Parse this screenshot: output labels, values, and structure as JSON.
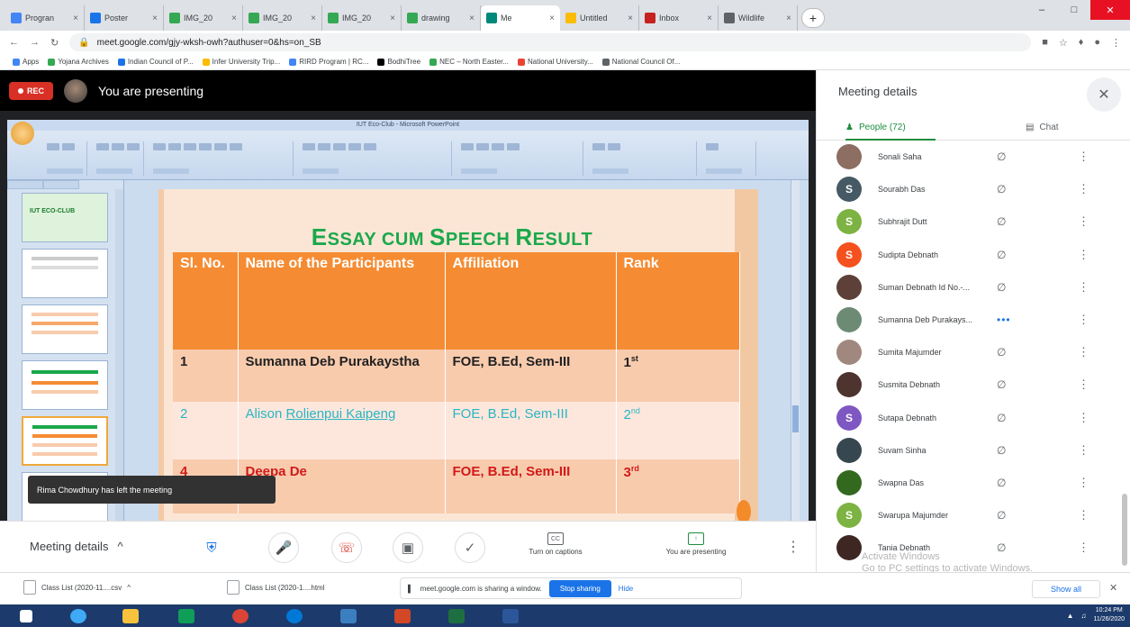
{
  "browser": {
    "tabs": [
      {
        "label": "Progran",
        "color": "#4285f4"
      },
      {
        "label": "Poster",
        "color": "#1a73e8"
      },
      {
        "label": "IMG_20",
        "color": "#34a853"
      },
      {
        "label": "IMG_20",
        "color": "#34a853"
      },
      {
        "label": "IMG_20",
        "color": "#34a853"
      },
      {
        "label": "drawing",
        "color": "#34a853"
      },
      {
        "label": "Me",
        "color": "#00897b"
      },
      {
        "label": "Untitled",
        "color": "#fbbc04"
      },
      {
        "label": "Inbox",
        "color": "#c5221f"
      },
      {
        "label": "Wildlife",
        "color": "#5f6368"
      }
    ],
    "url": "meet.google.com/gjy-wksh-owh?authuser=0&hs=on_SB",
    "bookmarks": [
      "Apps",
      "Yojana Archives",
      "Indian Council of P...",
      "Infer University Trip...",
      "RIRD Program | RC...",
      "BodhiTree",
      "NEC – North Easter...",
      "National University...",
      "National Council Of..."
    ]
  },
  "meet": {
    "rec_label": "REC",
    "presenting_text": "You are presenting",
    "toast": "Rima Chowdhury has left the meeting",
    "controls": {
      "meeting_details": "Meeting details",
      "captions": "Turn on captions",
      "presenting": "You are presenting"
    }
  },
  "ppt": {
    "title": "IUT Eco-Club - Microsoft PowerPoint",
    "thumb_label": "IUT ECO-CLUB"
  },
  "slide": {
    "title_e": "E",
    "title_ssay": "SSAY CUM ",
    "title_s": "S",
    "title_peech": "PEECH ",
    "title_r": "R",
    "title_esult": "ESULT",
    "headers": {
      "slno": "Sl. No.",
      "name": "Name of the Participants",
      "affiliation": "Affiliation",
      "rank": "Rank"
    },
    "rows": [
      {
        "no": "1",
        "name": "Sumanna Deb Purakaystha",
        "affiliation": "FOE, B.Ed, Sem-III",
        "rank": "1",
        "rank_sup": "st"
      },
      {
        "no": "2",
        "name_first": "Alison ",
        "name_rest": "Rolienpui Kaipeng",
        "affiliation": "FOE, B.Ed, Sem-III",
        "rank": "2",
        "rank_sup": "nd"
      },
      {
        "no": "4",
        "name": "Deepa De",
        "affiliation": "FOE, B.Ed, Sem-III",
        "rank": "3",
        "rank_sup": "rd"
      }
    ]
  },
  "panel": {
    "title": "Meeting details",
    "people_tab": "People (72)",
    "chat_tab": "Chat",
    "participants": [
      {
        "name": "Sonali Saha",
        "initial": "",
        "color": "#8d6e63"
      },
      {
        "name": "Sourabh Das",
        "initial": "S",
        "color": "#455a64"
      },
      {
        "name": "Subhrajit Dutt",
        "initial": "S",
        "color": "#7cb342"
      },
      {
        "name": "Sudipta Debnath",
        "initial": "S",
        "color": "#f4511e"
      },
      {
        "name": "Suman Debnath Id No.-...",
        "initial": "",
        "color": "#5d4037"
      },
      {
        "name": "Sumanna Deb Purakays...",
        "initial": "",
        "color": "#6d8b74"
      },
      {
        "name": "Sumita Majumder",
        "initial": "",
        "color": "#a1887f"
      },
      {
        "name": "Susmita Debnath",
        "initial": "",
        "color": "#4e342e"
      },
      {
        "name": "Sutapa Debnath",
        "initial": "S",
        "color": "#7e57c2"
      },
      {
        "name": "Suvam Sinha",
        "initial": "",
        "color": "#37474f"
      },
      {
        "name": "Swapna Das",
        "initial": "",
        "color": "#33691e"
      },
      {
        "name": "Swarupa Majumder",
        "initial": "S",
        "color": "#7cb342"
      },
      {
        "name": "Tania Debnath",
        "initial": "",
        "color": "#3e2723"
      }
    ],
    "watermark_line1": "Activate Windows",
    "watermark_line2": "Go to PC settings to activate Windows."
  },
  "downloads": {
    "file1": "Class List (2020-11....csv",
    "file2": "Class List (2020-1....html",
    "sharing_text": "meet.google.com is sharing a window.",
    "stop_sharing": "Stop sharing",
    "hide": "Hide",
    "show_all": "Show all"
  },
  "taskbar": {
    "time": "10:24 PM",
    "date": "11/26/2020"
  }
}
